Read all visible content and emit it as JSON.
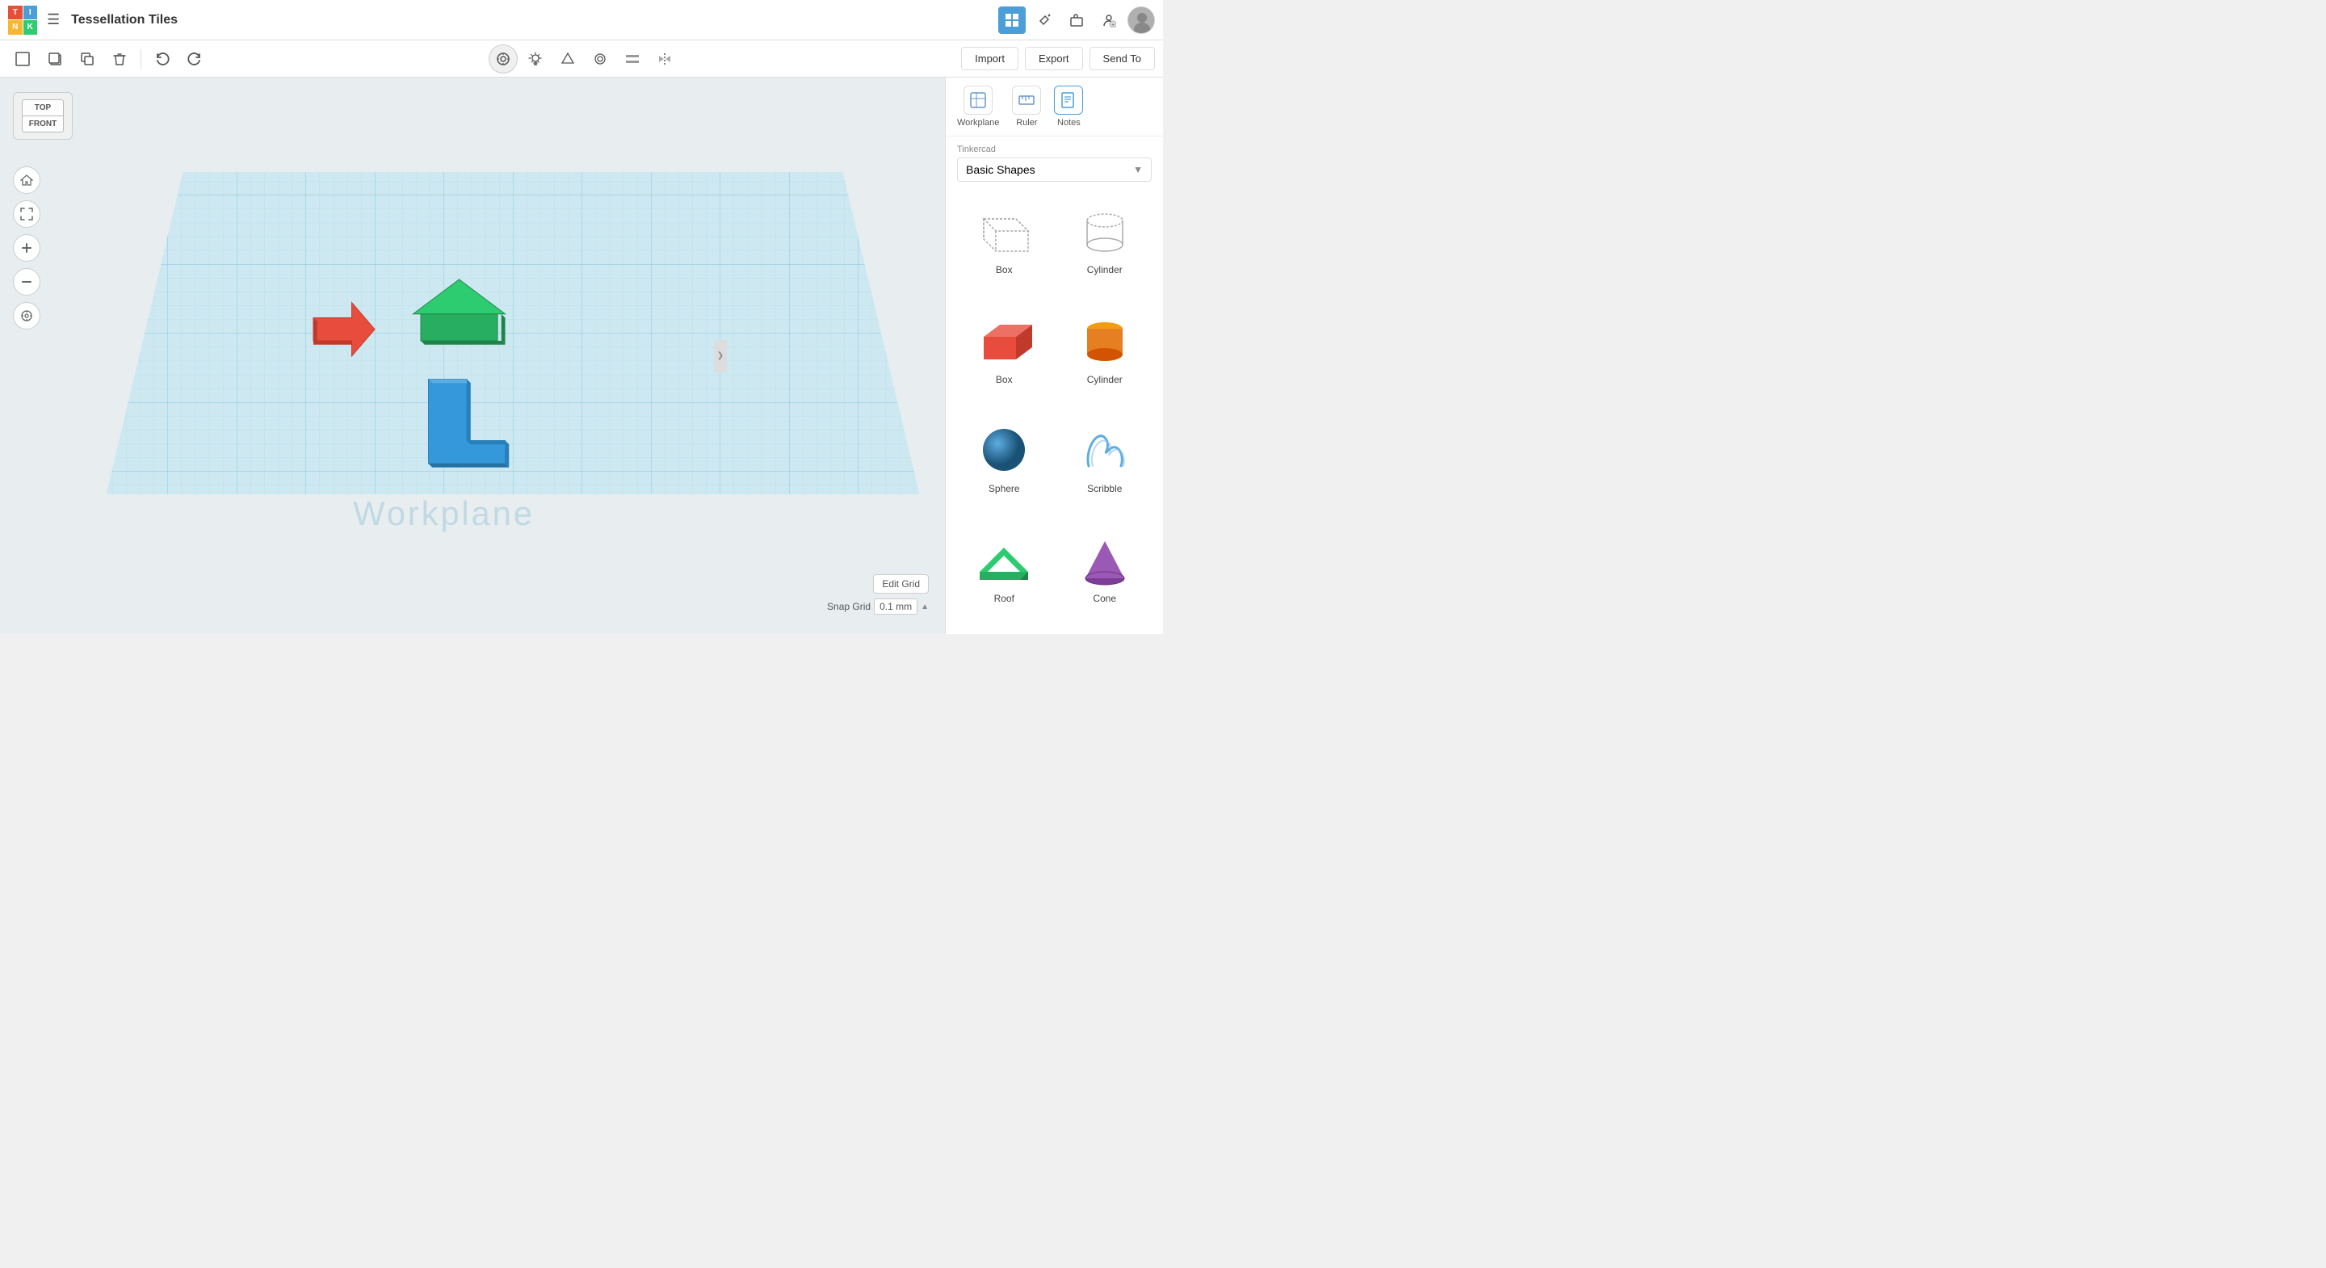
{
  "app": {
    "name": "Tinkercad",
    "logo_cells": [
      "T",
      "I",
      "N",
      "K"
    ],
    "logo_colors": [
      "#e94d35",
      "#4c9ed9",
      "#f7b731",
      "#2ecc71"
    ]
  },
  "header": {
    "design_icon": "☰",
    "title": "Tessellation Tiles"
  },
  "toolbar": {
    "new_btn": "□",
    "copy_btn": "⧉",
    "duplicate_btn": "⊡",
    "delete_btn": "🗑",
    "undo_btn": "↩",
    "redo_btn": "↪",
    "import_label": "Import",
    "export_label": "Export",
    "send_to_label": "Send To"
  },
  "view_controls": {
    "camera_icon": "⊙",
    "light_icon": "💡",
    "shape_icon": "△",
    "group_icon": "⬡",
    "align_icon": "⬛",
    "mirror_icon": "⇔"
  },
  "right_header_btns": {
    "grid_btn_active": true,
    "hammer_btn": false,
    "briefcase_btn": false,
    "person_btn": false
  },
  "view_cube": {
    "top_label": "TOP",
    "front_label": "FRONT"
  },
  "left_controls": {
    "home_icon": "⌂",
    "expand_icon": "⤢",
    "zoom_in_icon": "+",
    "zoom_out_icon": "−",
    "orient_icon": "◎"
  },
  "workplane": {
    "watermark": "Workplane",
    "edit_grid_label": "Edit Grid",
    "snap_grid_label": "Snap Grid",
    "snap_value": "0.1 mm",
    "snap_arrow": "▲"
  },
  "right_panel": {
    "workplane_label": "Workplane",
    "ruler_label": "Ruler",
    "notes_label": "Notes",
    "category_brand": "Tinkercad",
    "category_name": "Basic Shapes",
    "shapes": [
      {
        "label": "Box",
        "type": "box-outline",
        "color": "#aaa"
      },
      {
        "label": "Cylinder",
        "type": "cylinder-outline",
        "color": "#aaa"
      },
      {
        "label": "Box",
        "type": "box-solid",
        "color": "#e74c3c"
      },
      {
        "label": "Cylinder",
        "type": "cylinder-solid",
        "color": "#e67e22"
      },
      {
        "label": "Sphere",
        "type": "sphere-solid",
        "color": "#3498db"
      },
      {
        "label": "Scribble",
        "type": "scribble",
        "color": "#5dade2"
      },
      {
        "label": "Roof",
        "type": "roof",
        "color": "#2ecc71"
      },
      {
        "label": "Cone",
        "type": "cone",
        "color": "#9b59b6"
      }
    ],
    "collapse_arrow": "❯"
  }
}
